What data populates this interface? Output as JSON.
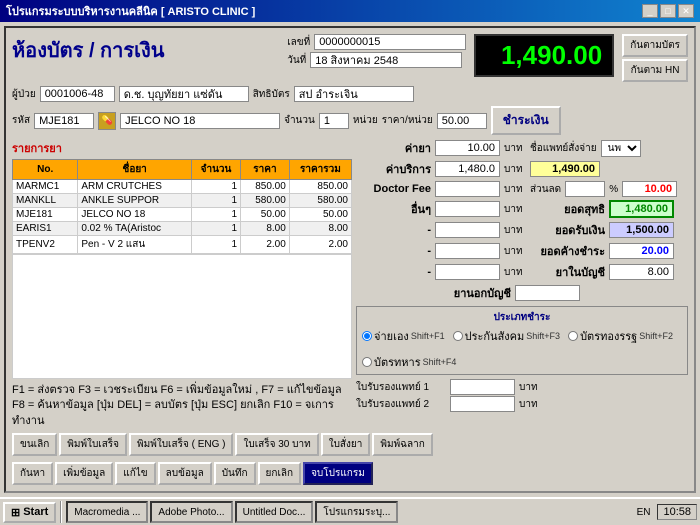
{
  "titleBar": {
    "text": "โปรแกรมระบบบริหารงานคลีนิค [ ARISTO CLINIC ]",
    "buttons": [
      "_",
      "□",
      "✕"
    ]
  },
  "header": {
    "title": "ห้องบัตร / การเงิน",
    "receiptLabel": "เลขที่",
    "receiptNumber": "0000000015",
    "dateLabel": "วันที่",
    "dateValue": "18 สิงหาคม 2548",
    "totalAmount": "1,490.00",
    "backBtn1": "กันตามบัตร",
    "backBtn2": "กันตาม HN"
  },
  "patient": {
    "label": "ผู้ป่วย",
    "id": "0001006-48",
    "name": "ด.ช. บุญทัยยา แซ่ดัน",
    "rightsLabel": "สิทธิบัตร",
    "rights": "สป อำระเจิน"
  },
  "medicineEntry": {
    "codeLabel": "รหัส",
    "code": "MJE181",
    "name": "JELCO NO 18",
    "qtyLabel": "จำนวน",
    "qty": "1",
    "unitLabel": "หน่วย",
    "unit": "",
    "priceLabel": "ราคา/หน่วย",
    "price": "50.00",
    "payLabel": "ชำระเงิน"
  },
  "sectionLabel": "รายการยา",
  "tableHeaders": [
    "No.",
    "ชื่อยา",
    "จำนวน",
    "ราคา",
    "ราคารวม"
  ],
  "tableRows": [
    {
      "no": "MARMC1",
      "name": "ARM CRUTCHES",
      "qty": "1",
      "price": "850.00",
      "total": "850.00"
    },
    {
      "no": "MANKLL",
      "name": "ANKLE SUPPOR",
      "qty": "1",
      "price": "580.00",
      "total": "580.00"
    },
    {
      "no": "MJE181",
      "name": "JELCO NO 18",
      "qty": "1",
      "price": "50.00",
      "total": "50.00"
    },
    {
      "no": "EARIS1",
      "name": "0.02 % TA(Aristoc",
      "qty": "1",
      "price": "8.00",
      "total": "8.00"
    },
    {
      "no": "TPENV2",
      "name": "Pen - V 2 แสน",
      "qty": "1",
      "price": "2.00",
      "total": "2.00"
    }
  ],
  "fees": {
    "drugLabel": "ค่ายา",
    "drugValue": "10.00",
    "drugUnit": "บาท",
    "serviceLabel": "ค่าบริการ",
    "serviceValue": "1,480.0",
    "serviceUnit": "บาท",
    "doctorLabel": "Doctor Fee",
    "doctorValue": "",
    "doctorUnit": "บาท",
    "otherLabel": "อื่นๆ",
    "otherValue": "",
    "otherUnit": "บาท",
    "dash1": "-",
    "dash1Unit": "บาท",
    "dash2": "-",
    "dash2Unit": "บาท",
    "dash3": "-",
    "dash3Unit": "บาท"
  },
  "discountLabel": "ส่วนลด",
  "discountPct": "%",
  "discountPctValue": "10.00",
  "subtotalLabel": "ยอดสุทธิ",
  "subtotalValue": "1,480.00",
  "cashLabel": "ยอดรับเงิน",
  "cashValue": "1,500.00",
  "changeLabel": "ยอดคัางชำระ",
  "changeValue": "20.00",
  "medBudgetLabel": "ยาในบัญชี",
  "medBudgetValue": "8.00",
  "medOutLabel": "ยานอกบัญชี",
  "medOutValue": "",
  "medTypeLabel": "ชื่อแพทย์สั่งจ่าย",
  "medTypeSelect": "นพ",
  "payTypeTitle": "ประเภทชำระ",
  "payTypes": [
    {
      "label": "จ่ายเอง",
      "shortcut": "Shift+F1"
    },
    {
      "label": "ประกันสังคม",
      "shortcut": "Shift+F3"
    },
    {
      "label": "บัตรทองรรฐ",
      "shortcut": "Shift+F2"
    },
    {
      "label": "บัตรทหาร",
      "shortcut": "Shift+F4"
    }
  ],
  "insuranceRows": [
    {
      "label": "ใบรับรองแพทย์ 1",
      "value": "",
      "unit": "บาท"
    },
    {
      "label": "ใบรับรองแพทย์ 2",
      "value": "",
      "unit": "บาท"
    }
  ],
  "shortcuts": "F1 = ส่งตรวจ  F3 = เวชระเบียน F6 = เพิ่มข้อมูลใหม่ , F7 = แก้ไขข้อมูล\nF8 = ค้นหาข้อมูล [ปุ่ม DEL] = ลบบัตร [ปุ่ม ESC] ยกเลิก F10 = จเการทำงาน",
  "bottomBtns1": [
    "ขนเลิก",
    "พิมพ์ใบเสร็จ",
    "พิมพ์ใบเสร็จ ( ENG )",
    "ใบเสร็จ 30 บาท",
    "ใบสั่งยา",
    "พิมพ์ฉลาก"
  ],
  "bottomBtns2": [
    "กันหา",
    "เพิ่มข้อมูล",
    "แก้ไข",
    "ลบข้อมูล",
    "บันทึก",
    "ยกเลิก",
    "จบโปรแกรม"
  ],
  "taskbar": {
    "startLabel": "Start",
    "items": [
      "Macromedia ...",
      "Adobe Photo...",
      "Untitled Doc...",
      "โปรแกรมระบุ..."
    ],
    "lang": "EN",
    "time": "10:58"
  }
}
